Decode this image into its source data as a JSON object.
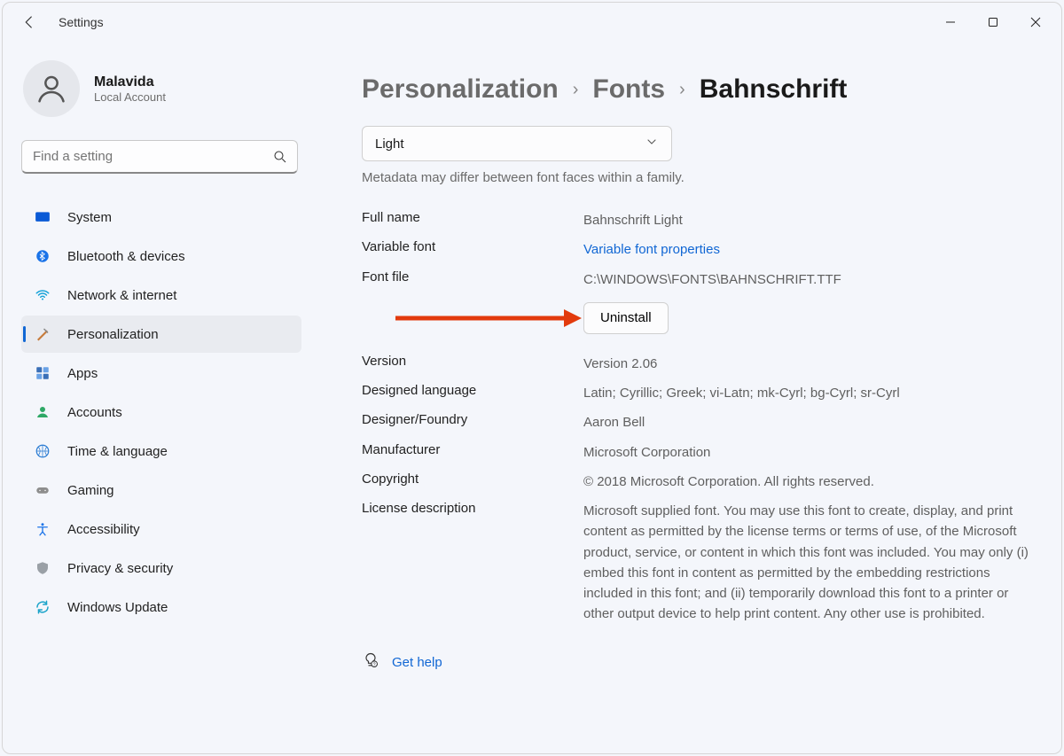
{
  "window": {
    "title": "Settings"
  },
  "user": {
    "name": "Malavida",
    "subtitle": "Local Account"
  },
  "search": {
    "placeholder": "Find a setting"
  },
  "nav": {
    "items": [
      {
        "label": "System"
      },
      {
        "label": "Bluetooth & devices"
      },
      {
        "label": "Network & internet"
      },
      {
        "label": "Personalization"
      },
      {
        "label": "Apps"
      },
      {
        "label": "Accounts"
      },
      {
        "label": "Time & language"
      },
      {
        "label": "Gaming"
      },
      {
        "label": "Accessibility"
      },
      {
        "label": "Privacy & security"
      },
      {
        "label": "Windows Update"
      }
    ]
  },
  "breadcrumb": {
    "a": "Personalization",
    "b": "Fonts",
    "c": "Bahnschrift"
  },
  "face_select": {
    "value": "Light"
  },
  "meta_note": "Metadata may differ between font faces within a family.",
  "details": {
    "full_name": {
      "label": "Full name",
      "value": "Bahnschrift Light"
    },
    "variable_font": {
      "label": "Variable font",
      "value": "Variable font properties"
    },
    "font_file": {
      "label": "Font file",
      "value": "C:\\WINDOWS\\FONTS\\BAHNSCHRIFT.TTF"
    },
    "uninstall_label": "Uninstall",
    "version": {
      "label": "Version",
      "value": "Version 2.06"
    },
    "designed_language": {
      "label": "Designed language",
      "value": "Latin; Cyrillic; Greek; vi-Latn; mk-Cyrl; bg-Cyrl; sr-Cyrl"
    },
    "designer": {
      "label": "Designer/Foundry",
      "value": "Aaron Bell"
    },
    "manufacturer": {
      "label": "Manufacturer",
      "value": "Microsoft Corporation"
    },
    "copyright": {
      "label": "Copyright",
      "value": "© 2018 Microsoft Corporation. All rights reserved."
    },
    "license": {
      "label": "License description",
      "value": "Microsoft supplied font. You may use this font to create, display, and print content as permitted by the license terms or terms of use, of the Microsoft product, service, or content in which this font was included. You may only (i) embed this font in content as permitted by the embedding restrictions included in this font; and (ii) temporarily download this font to a printer or other output device to help print content. Any other use is prohibited."
    }
  },
  "help": {
    "label": "Get help"
  }
}
